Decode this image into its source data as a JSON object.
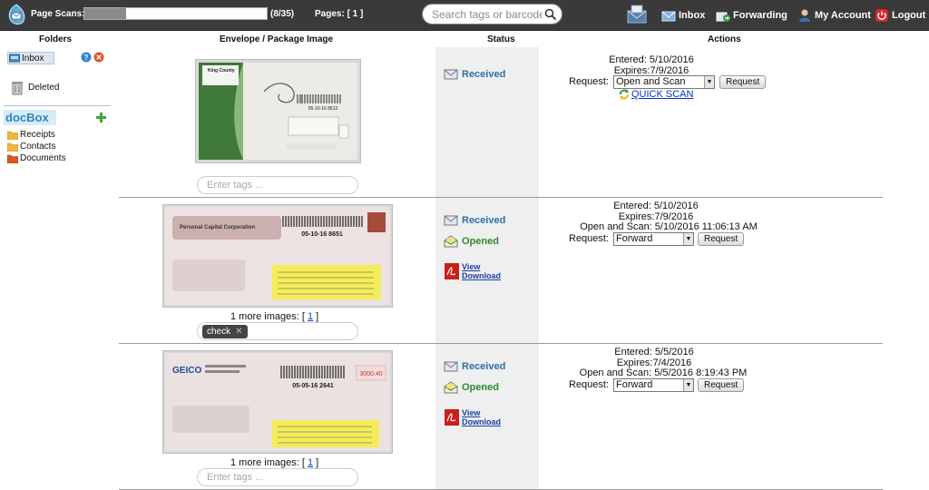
{
  "topbar": {
    "scan_label": "Page Scans:",
    "scan_progress": 0.23,
    "scan_count": "(8/35)",
    "pages_label": "Pages: [ 1 ]",
    "search_placeholder": "Search tags or barcodes...",
    "nav": [
      {
        "label": "Inbox",
        "icon": "inbox-icon"
      },
      {
        "label": "Forwarding",
        "icon": "forwarding-icon"
      },
      {
        "label": "My Account",
        "icon": "user-icon"
      },
      {
        "label": "Logout",
        "icon": "power-icon"
      }
    ]
  },
  "columns": {
    "folders": "Folders",
    "image": "Envelope / Package Image",
    "status": "Status",
    "actions": "Actions"
  },
  "sidebar": {
    "inbox": "Inbox",
    "deleted": "Deleted",
    "docbox_logo": "docBox",
    "folders": [
      "Receipts",
      "Contacts",
      "Documents"
    ]
  },
  "items": [
    {
      "envelope_text": {
        "org": "King County",
        "barcode": "05-10-16 8612"
      },
      "tags_placeholder": "Enter tags ...",
      "tags": [],
      "more_images": null,
      "status": {
        "received": "Received",
        "opened": null
      },
      "entered": "Entered: 5/10/2016",
      "expires": "Expires:7/9/2016",
      "open_scan": null,
      "request_label": "Request:",
      "request_value": "Open and Scan",
      "request_button": "Request",
      "quick_scan": "QUICK SCAN"
    },
    {
      "envelope_text": {
        "org": "Personal Capital Corporation",
        "barcode": "05-10-16 8651"
      },
      "tags_placeholder": "",
      "tags": [
        "check"
      ],
      "more_images": {
        "text": "1 more images: [",
        "link": "1",
        "close": "]"
      },
      "status": {
        "received": "Received",
        "opened": "Opened",
        "view": "View",
        "download": "Download"
      },
      "entered": "Entered: 5/10/2016",
      "expires": "Expires:7/9/2016",
      "open_scan": "Open and Scan: 5/10/2016 11:06:13 AM",
      "request_label": "Request:",
      "request_value": "Forward",
      "request_button": "Request"
    },
    {
      "envelope_text": {
        "org": "GEICO",
        "barcode": "05-05-16 2641",
        "postage": "3000.40"
      },
      "tags_placeholder": "Enter tags ...",
      "tags": [],
      "more_images": {
        "text": "1 more images: [",
        "link": "1",
        "close": "]"
      },
      "status": {
        "received": "Received",
        "opened": "Opened",
        "view": "View",
        "download": "Download"
      },
      "entered": "Entered: 5/5/2016",
      "expires": "Expires:7/4/2016",
      "open_scan": "Open and Scan: 5/5/2016 8:19:43 PM",
      "request_label": "Request:",
      "request_value": "Forward",
      "request_button": "Request"
    }
  ]
}
